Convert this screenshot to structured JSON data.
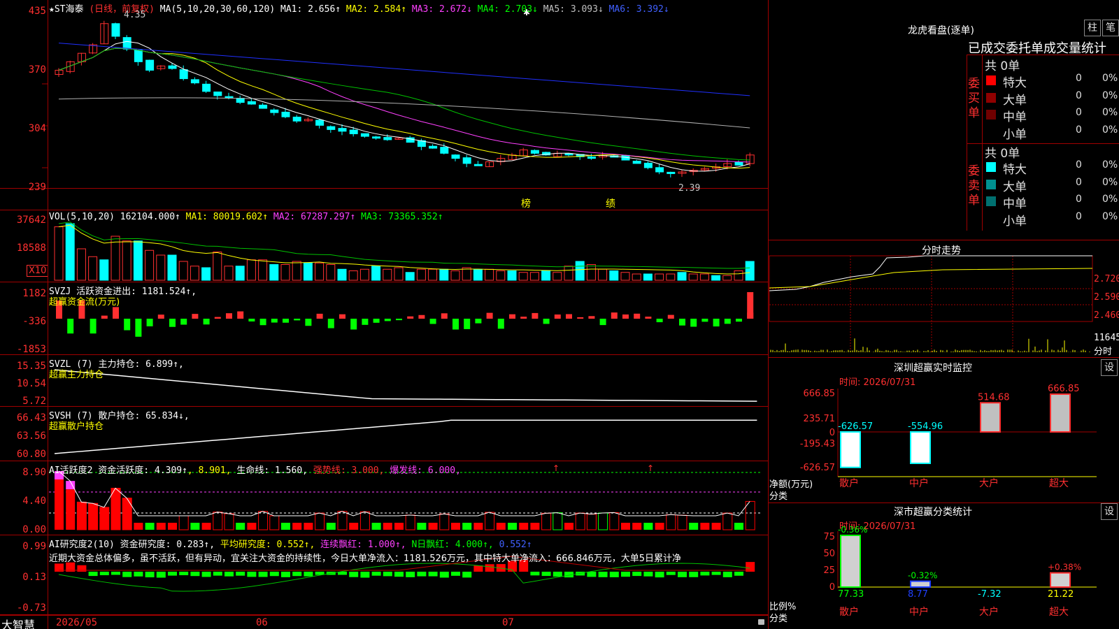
{
  "main_chart": {
    "stock_name": "★ST海泰",
    "period": "(日线，前复权)",
    "ma_label": "MA(5,10,20,30,60,120)",
    "ma_values": [
      {
        "label": "MA1: 2.656↑",
        "color": "#ffffff"
      },
      {
        "label": "MA2: 2.584↑",
        "color": "#ffff00"
      },
      {
        "label": "MA3: 2.672↓",
        "color": "#ff40ff"
      },
      {
        "label": "MA4: 2.703↓",
        "color": "#00ff00"
      },
      {
        "label": "MA5: 3.093↓",
        "color": "#c0c0c0"
      },
      {
        "label": "MA6: 3.392↓",
        "color": "#4060ff"
      }
    ],
    "y_ticks": [
      "435",
      "370",
      "304",
      "239"
    ],
    "high_label": "4.35",
    "low_label": "2.39",
    "annotations": [
      "榜",
      "绩"
    ]
  },
  "volume_panel": {
    "label": "VOL(5,10,20)",
    "value": "162104.000↑",
    "ma1": "MA1: 80019.602↑",
    "ma2": "MA2: 67287.297↑",
    "ma3": "MA3: 73365.352↑",
    "y_ticks": [
      "37642",
      "18588"
    ],
    "unit": "X10"
  },
  "svzj_panel": {
    "label": "SVZJ  活跃资金进出: 1181.524↑,",
    "sublabel": "超赢资金流(万元)",
    "y_ticks": [
      "1182",
      "-336",
      "-1853"
    ]
  },
  "svzl_panel": {
    "label": "SVZL (7) 主力持仓: 6.899↑,",
    "sublabel": "超赢主力持仓",
    "y_ticks": [
      "15.35",
      "10.54",
      "5.72"
    ]
  },
  "svsh_panel": {
    "label": "SVSH (7) 散户持仓: 65.834↓,",
    "sublabel": "超赢散户持仓",
    "y_ticks": [
      "66.43",
      "63.56",
      "60.80"
    ]
  },
  "ai_active_panel": {
    "label_a": "AI活跃度2 资金活跃度: 4.309↑",
    "label_b": ", 8.901,",
    "label_c": "生命线: 1.560,",
    "label_d": "强势线: 3.000,",
    "label_e": "爆发线: 6.000,",
    "y_ticks": [
      "8.90",
      "4.40",
      "0.00"
    ]
  },
  "ai_research_panel": {
    "label_a": "AI研究度2(10) 资金研究度: 0.283↑,",
    "label_b": "平均研究度: 0.552↑,",
    "label_c": "连续飘红: 1.000↑,",
    "label_d": "N日飘红: 4.000↑,",
    "label_e": "0.552↑",
    "description": "近期大资金总体偏多，虽不活跃，但有异动，宜关注大资金的持续性，今日大单净流入：1181.526万元，其中特大单净流入：666.846万元，大单5日累计净",
    "y_ticks": [
      "0.99",
      "0.13",
      "-0.73"
    ]
  },
  "x_axis": {
    "brand": "大智慧",
    "labels": [
      "2026/05",
      "06",
      "07"
    ]
  },
  "right_panel": {
    "dragon_title": "龙虎看盘(逐单)",
    "btn_zhu": "柱",
    "btn_bi": "笔",
    "stats_title": "已成交委托单成交量统计",
    "buy_side": "委买单",
    "sell_side": "委卖单",
    "buy_total": "共 0单",
    "sell_total": "共 0单",
    "rows": [
      {
        "name": "特大",
        "count": "0",
        "pct": "0%"
      },
      {
        "name": "大单",
        "count": "0",
        "pct": "0%"
      },
      {
        "name": "中单",
        "count": "0",
        "pct": "0%"
      },
      {
        "name": "小单",
        "count": "0",
        "pct": "0%"
      }
    ],
    "buy_colors": [
      "#ff0000",
      "#900000",
      "#700000",
      ""
    ],
    "sell_colors": [
      "#00ffff",
      "#009090",
      "#007070",
      ""
    ],
    "intraday_title": "分时走势",
    "intraday_ticks": [
      "2.720",
      "2.590",
      "2.460",
      "11645",
      "分时"
    ],
    "sz_title": "深圳超赢实时监控",
    "sz_btn": "设",
    "time_label": "时间: 2026/07/31",
    "sz_y_ticks": [
      "666.85",
      "235.71",
      "0",
      "-195.43",
      "-626.57"
    ],
    "sz_values": [
      "-626.57",
      "-554.96",
      "514.68",
      "666.85"
    ],
    "sz_ylabel": "净额(万元)",
    "sz_xlabel": "分类",
    "categories": [
      "散户",
      "中户",
      "大户",
      "超大"
    ],
    "cls_title": "深市超赢分类统计",
    "cls_btn": "设",
    "cls_time": "时间: 2026/07/31",
    "cls_y_ticks": [
      "75",
      "50",
      "25",
      "0"
    ],
    "cls_top_labels": [
      "-0.36%",
      "-0.32%",
      "",
      "+0.38%"
    ],
    "cls_bottom_labels": [
      "77.33",
      "8.77",
      "-7.32",
      "21.22"
    ],
    "cls_ylabel": "比例%",
    "cls_xlabel": "分类"
  }
}
